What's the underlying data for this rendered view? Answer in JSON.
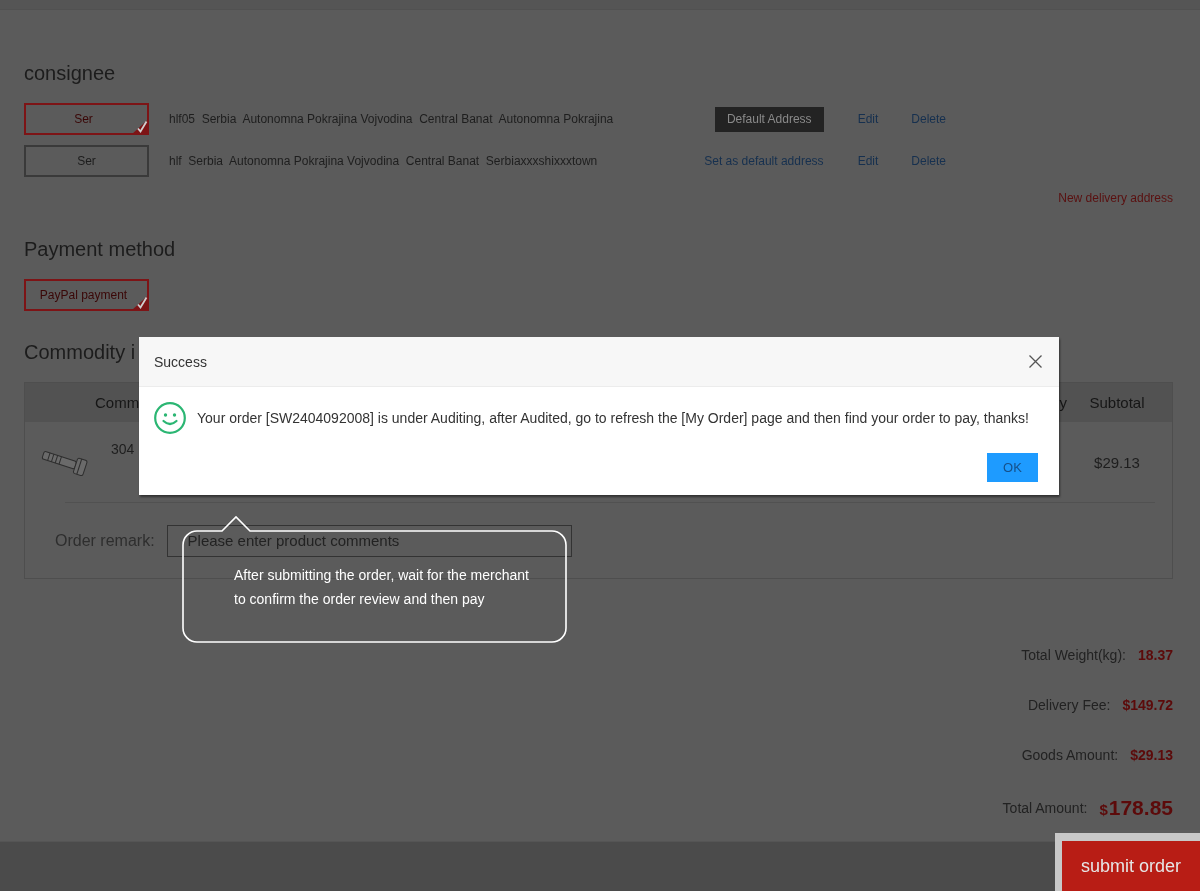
{
  "consignee": {
    "title": "consignee",
    "addresses": [
      {
        "name": "Ser",
        "selected": true,
        "detail": "hlf05  Serbia  Autonomna Pokrajina Vojvodina  Central Banat  Autonomna Pokrajina",
        "is_default": true,
        "default_action": "Default Address",
        "edit": "Edit",
        "delete": "Delete"
      },
      {
        "name": "Ser",
        "selected": false,
        "detail": "hlf  Serbia  Autonomna Pokrajina Vojvodina  Central Banat  Serbiaxxxshixxxtown",
        "is_default": false,
        "default_action": "Set as default address",
        "edit": "Edit",
        "delete": "Delete"
      }
    ],
    "new_address": "New delivery address"
  },
  "payment": {
    "title": "Payment method",
    "methods": [
      {
        "label": "PayPal payment",
        "selected": true
      }
    ]
  },
  "commodity": {
    "title": "Commodity i",
    "columns": [
      "Comm",
      "y",
      "Subtotal"
    ],
    "items": [
      {
        "name": "304",
        "subtotal": "$29.13"
      }
    ],
    "remark": {
      "label": "Order remark:",
      "placeholder": "Please enter product comments"
    }
  },
  "summary": [
    {
      "kind": "line",
      "label": "Total Weight(kg):",
      "value": "18.37"
    },
    {
      "kind": "line",
      "label": "Delivery Fee:",
      "value": "$149.72"
    },
    {
      "kind": "line",
      "label": "Goods Amount:",
      "value": "$29.13"
    },
    {
      "kind": "total",
      "label": "Total Amount:",
      "currency": "$",
      "value": "178.85"
    }
  ],
  "submit_button": "submit order",
  "dialog": {
    "title": "Success",
    "message": "Your order [SW2404092008] is under Auditing, after Audited, go to refresh the [My Order] page and then find your order to pay, thanks!",
    "button": "OK"
  },
  "guide_tip": "After submitting the order, wait for the merchant to confirm the order review and then pay"
}
